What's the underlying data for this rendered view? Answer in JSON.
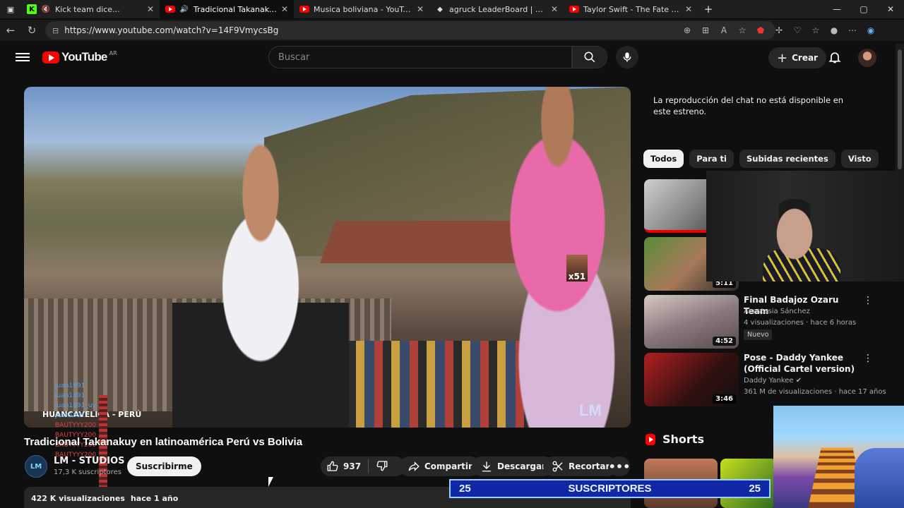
{
  "tabs": [
    {
      "title": "Kick team dice...",
      "icon": "kick-favicon-icon",
      "muted": true,
      "active": false
    },
    {
      "title": "Tradicional Takanakuy en lati",
      "icon": "youtube-favicon-icon",
      "audio": true,
      "active": true
    },
    {
      "title": "Musica boliviana - YouTube",
      "icon": "youtube-favicon-icon",
      "active": false
    },
    {
      "title": "agruck LeaderBoard | The best Ch",
      "icon": "diamond-favicon-icon",
      "active": false
    },
    {
      "title": "Taylor Swift - The Fate of Ophelia",
      "icon": "youtube-favicon-icon",
      "active": false
    }
  ],
  "url": "https://www.youtube.com/watch?v=14F9VmycsBg",
  "header": {
    "logo_text": "YouTube",
    "country_code": "AR",
    "search_placeholder": "Buscar",
    "create_label": "Crear"
  },
  "video": {
    "title": "Tradicional Takanakuy en latinoamérica Perú vs Bolivia",
    "overlay_location": "HUANCAVELICA - PERÚ",
    "watermark": "LM",
    "sticker_label": "x51",
    "channel_name": "LM - STUDIOS",
    "channel_initials": "LM",
    "channel_subs": "17,3 K suscriptores",
    "subscribe_label": "Suscribirme",
    "likes": "937",
    "share_label": "Compartir",
    "download_label": "Descargar",
    "clip_label": "Recortar",
    "views": "422 K visualizaciones",
    "posted": "hace 1 año"
  },
  "stream_chat_overlay": [
    "juan1891",
    "juan1891",
    "juan1891_uy",
    "juan1891",
    "BAUTYYY200",
    "BAUTYYY200",
    "BAUTYYY200",
    "BAUTYYY200"
  ],
  "chat_note": "La reproducción del chat no está disponible en este estreno.",
  "chips": [
    "Todos",
    "Para ti",
    "Subidas recientes",
    "Visto"
  ],
  "recommendations": [
    {
      "duration": "",
      "title": "",
      "channel": "",
      "meta": ""
    },
    {
      "duration": "5:11",
      "title": "",
      "channel": "",
      "meta": ""
    },
    {
      "duration": "4:52",
      "title": "Final Badajoz Ozaru Team",
      "channel": "Anastasia Sánchez",
      "meta": "4 visualizaciones · hace 6 horas",
      "badge": "Nuevo"
    },
    {
      "duration": "3:46",
      "title": "Pose - Daddy Yankee (Official Cartel version)",
      "channel": "Daddy Yankee",
      "meta": "361 M de visualizaciones · hace 17 años"
    }
  ],
  "shorts_label": "Shorts",
  "subs_banner": {
    "left": "25",
    "label": "SUSCRIPTORES",
    "right": "25"
  }
}
